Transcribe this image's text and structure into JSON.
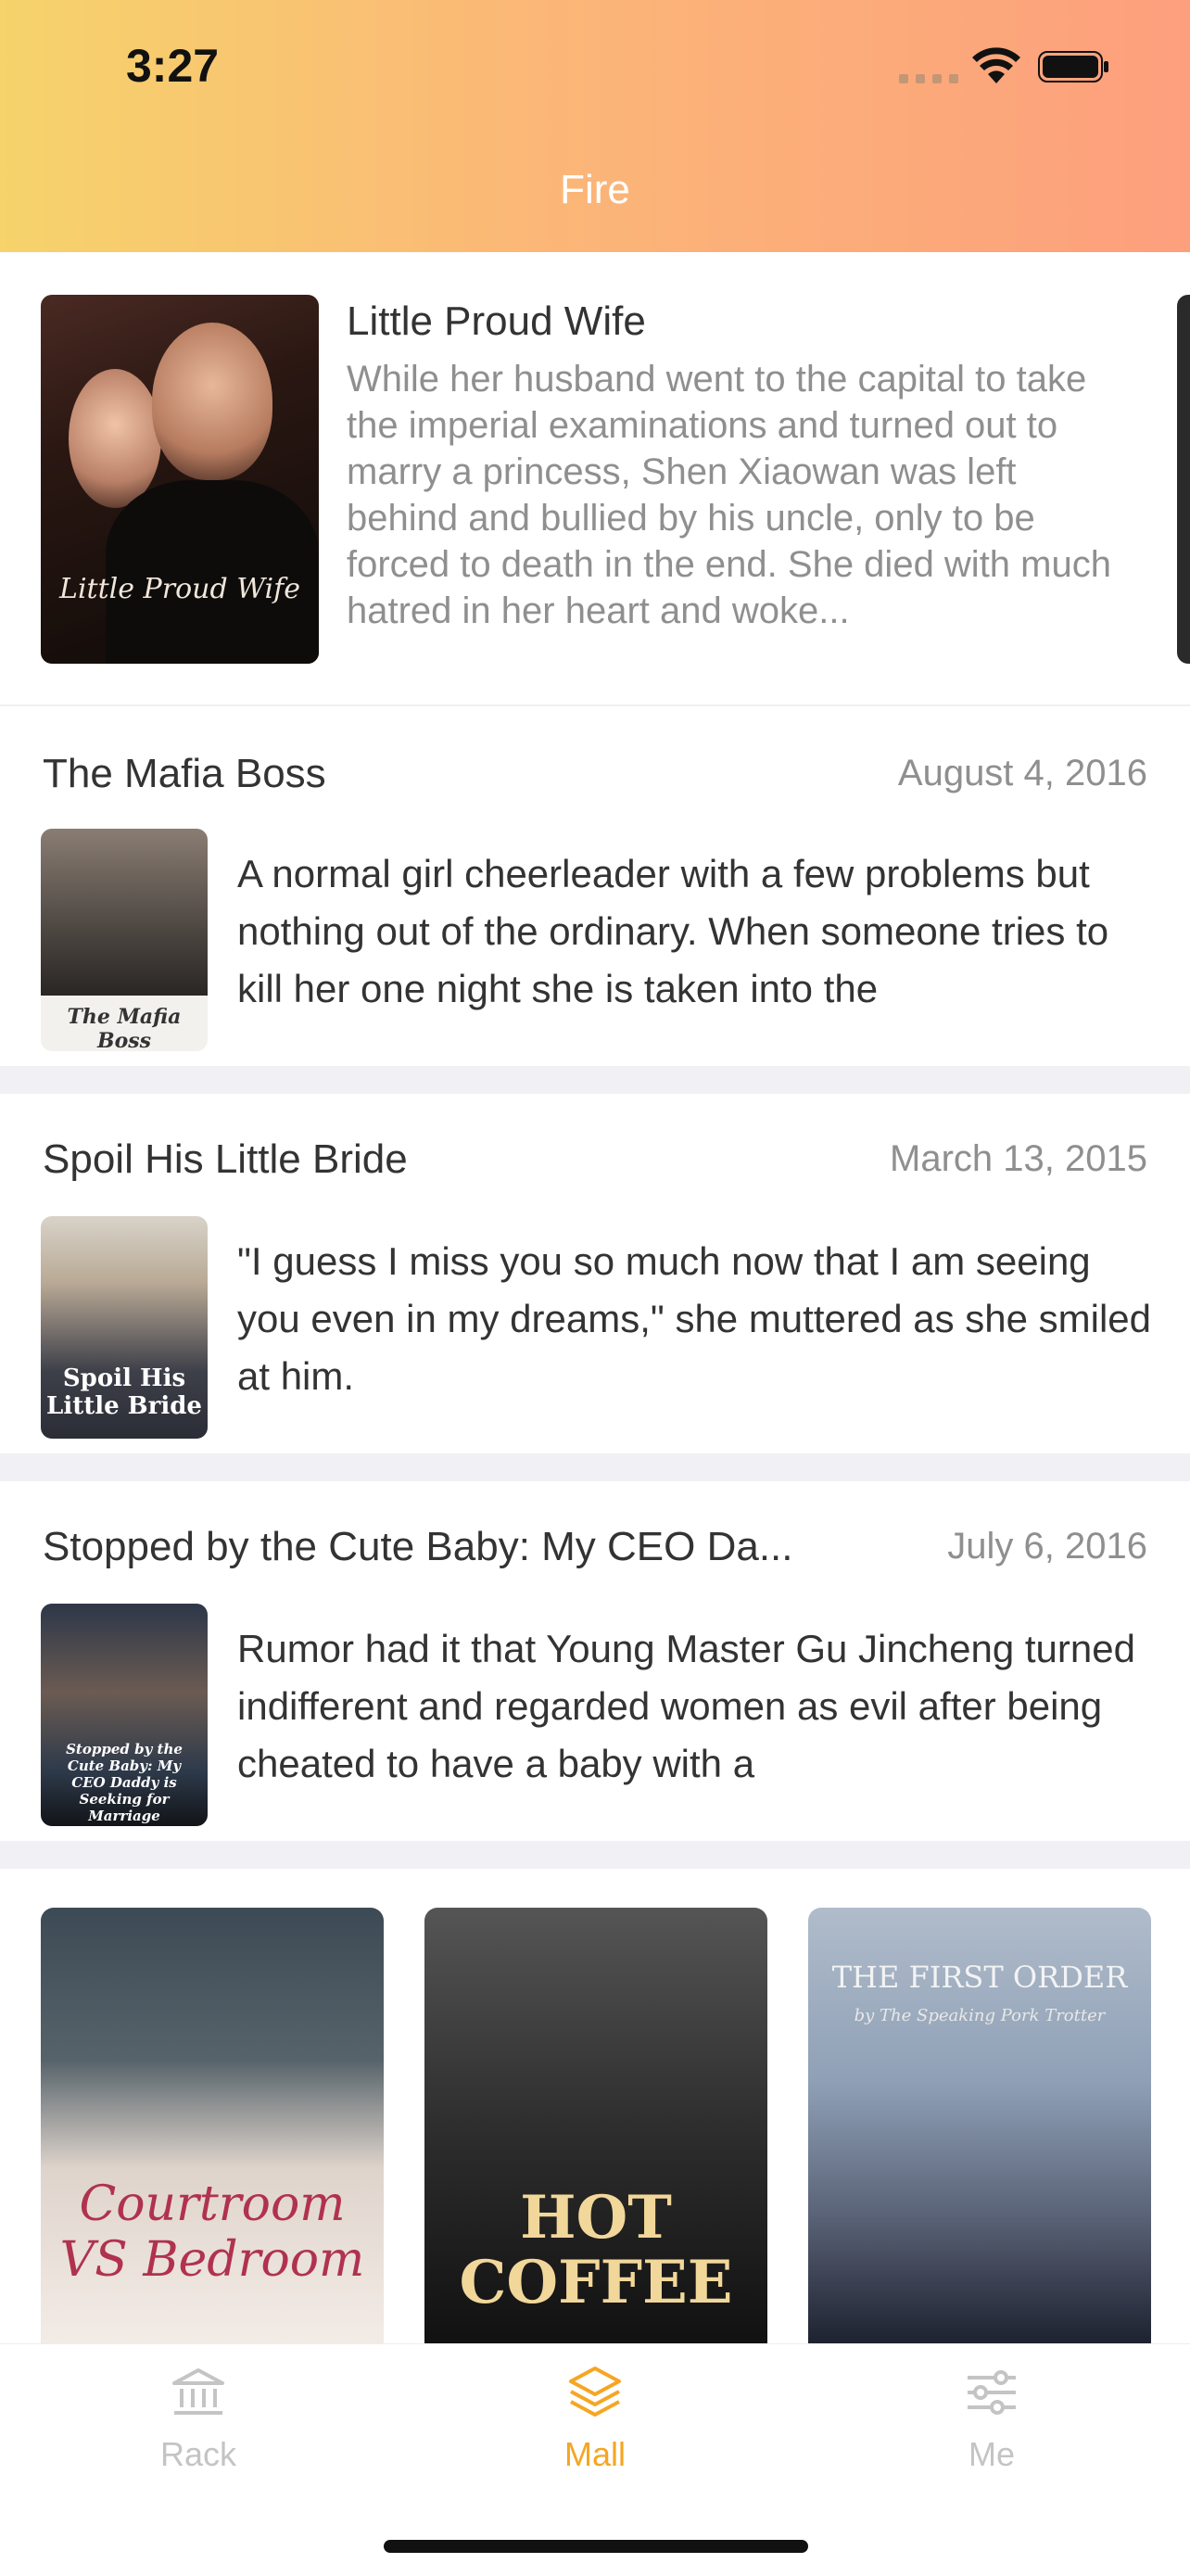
{
  "status_bar": {
    "time": "3:27"
  },
  "nav": {
    "title": "Fire"
  },
  "featured": {
    "title": "Little Proud Wife",
    "cover_text": "Little Proud Wife",
    "description": "While her husband went to the capital to take the imperial examinations and turned out to marry a princess, Shen Xiaowan was left behind and bullied by his uncle, only to be forced to death in the end. She died with much hatred in her heart and woke..."
  },
  "list": [
    {
      "title": "The Mafia Boss",
      "date": "August 4, 2016",
      "cover_text": "The Mafia Boss",
      "excerpt": "A normal girl cheerleader with a few problems but nothing out of the ordinary. When someone tries to kill her one night she is taken into the"
    },
    {
      "title": "Spoil His Little Bride",
      "date": "March 13, 2015",
      "cover_text": "Spoil His Little Bride",
      "excerpt": "\"I guess I miss you so much now that I am seeing you even in my dreams,\" she muttered as she smiled at him."
    },
    {
      "title": "Stopped by the Cute Baby: My CEO Da...",
      "date": "July 6, 2016",
      "cover_text": "Stopped by the Cute Baby: My CEO Daddy is Seeking for Marriage",
      "excerpt": "Rumor had it that Young Master Gu Jincheng turned indifferent and regarded women as evil after being cheated to have a baby with a"
    }
  ],
  "grid": [
    {
      "cover_text": "Courtroom VS Bedroom"
    },
    {
      "cover_text": "HOT COFFEE"
    },
    {
      "cover_text": "THE FIRST ORDER",
      "cover_subtext": "by The Speaking Pork Trotter"
    }
  ],
  "tabs": [
    {
      "label": "Rack",
      "icon": "bank-icon",
      "active": false
    },
    {
      "label": "Mall",
      "icon": "layers-icon",
      "active": true
    },
    {
      "label": "Me",
      "icon": "sliders-icon",
      "active": false
    }
  ],
  "colors": {
    "accent": "#f5a623",
    "inactive": "#c4c4c4",
    "header_start": "#f6d36b",
    "header_end": "#fd9f7d"
  }
}
